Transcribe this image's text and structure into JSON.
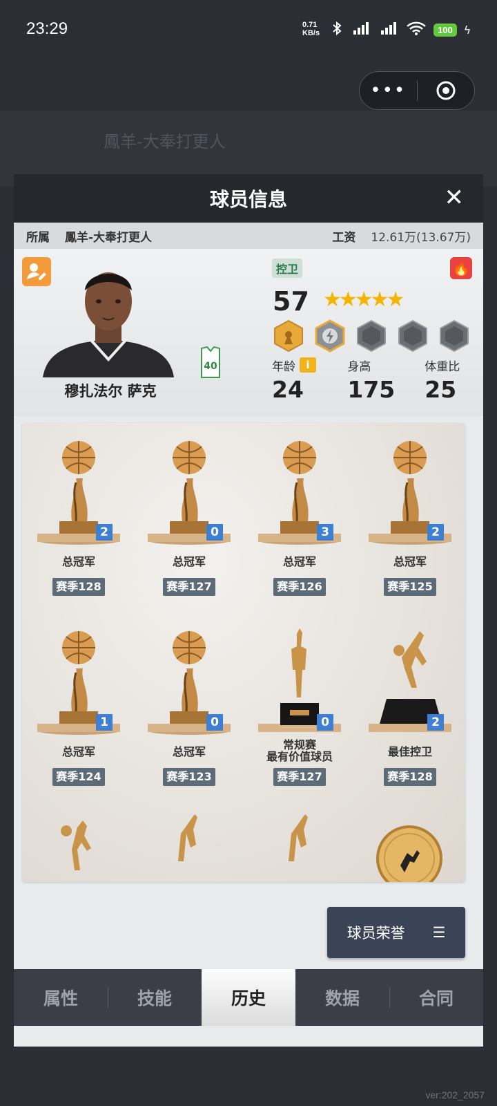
{
  "status": {
    "time": "23:29",
    "net_top": "0.71",
    "net_bottom": "KB/s",
    "battery": "100"
  },
  "capsule": {
    "more": "•••"
  },
  "background": {
    "team_title": "鳳羊-大奉打更人"
  },
  "modal": {
    "title": "球员信息",
    "close": "✕",
    "info": {
      "team_label": "所属",
      "team": "鳳羊-大奉打更人",
      "salary_label": "工资",
      "salary": "12.61万(13.67万)"
    },
    "player": {
      "name": "穆扎法尔 萨克",
      "position": "控卫",
      "overall": "57",
      "stars": "★★★★★",
      "jersey_number": "40",
      "stats": [
        {
          "label": "年龄",
          "value": "24"
        },
        {
          "label": "身高",
          "value": "175"
        },
        {
          "label": "体重比",
          "value": "25"
        }
      ],
      "info_icon": "i",
      "fire_icon": "🔥"
    },
    "trophies": [
      {
        "name": "总冠军",
        "season": "赛季128",
        "count": "2",
        "icon": "ball-trophy"
      },
      {
        "name": "总冠军",
        "season": "赛季127",
        "count": "0",
        "icon": "ball-trophy"
      },
      {
        "name": "总冠军",
        "season": "赛季126",
        "count": "3",
        "icon": "ball-trophy"
      },
      {
        "name": "总冠军",
        "season": "赛季125",
        "count": "2",
        "icon": "ball-trophy"
      },
      {
        "name": "总冠军",
        "season": "赛季124",
        "count": "1",
        "icon": "ball-trophy"
      },
      {
        "name": "总冠军",
        "season": "赛季123",
        "count": "0",
        "icon": "ball-trophy"
      },
      {
        "name_line1": "常规赛",
        "name_line2": "最有价值球员",
        "season": "赛季127",
        "count": "0",
        "icon": "mvp-trophy"
      },
      {
        "name": "最佳控卫",
        "season": "赛季128",
        "count": "2",
        "icon": "player-trophy"
      }
    ],
    "honor_button": {
      "label": "球员荣誉",
      "icon": "☰"
    },
    "tabs": [
      {
        "label": "属性",
        "active": false
      },
      {
        "label": "技能",
        "active": false
      },
      {
        "label": "历史",
        "active": true
      },
      {
        "label": "数据",
        "active": false
      },
      {
        "label": "合同",
        "active": false
      }
    ]
  },
  "version": "ver:202_2057",
  "colors": {
    "accent_blue": "#3d7fd2",
    "tab_bar": "#3b3e46",
    "position_green": "#2b7a4a",
    "gold": "#c8944a"
  }
}
